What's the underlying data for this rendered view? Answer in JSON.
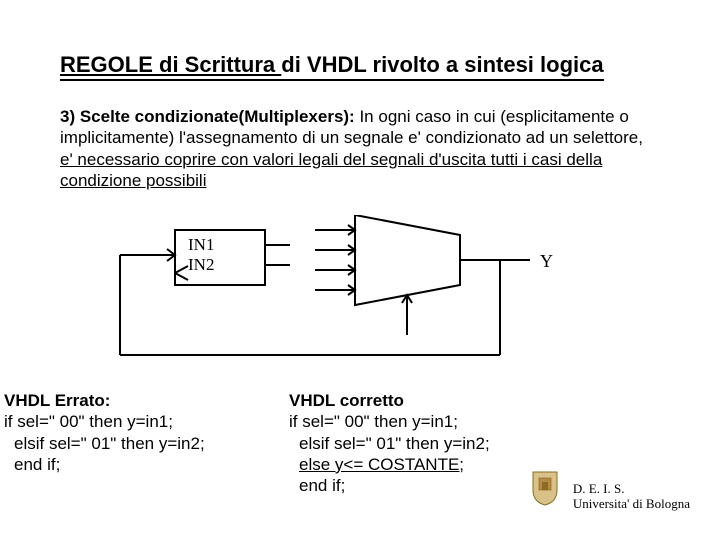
{
  "title": {
    "part1": "REGOLE di Scrittura ",
    "part2": "di VHDL rivolto a sintesi logica"
  },
  "paragraph": {
    "lead": "3) Scelte condizionate(Multiplexers):",
    "rest1": " In ogni caso in cui (esplicitamente o implicitamente) l'assegnamento di un segnale e' condizionato ad un selettore, ",
    "under": "e' necessario coprire con valori legali del segnali d'uscita tutti i casi della condizione possibili"
  },
  "diagram": {
    "in1": "IN1",
    "in2": "IN2",
    "out": "Y"
  },
  "left": {
    "header": "VHDL Errato:",
    "l1": "if sel=\" 00\" then y=in1;",
    "l2": "elsif sel=\" 01\" then y=in2;",
    "l3": "end if;"
  },
  "right": {
    "header": "VHDL  corretto",
    "l1": "if sel=\" 00\" then y=in1;",
    "l2": "elsif sel=\" 01\" then y=in2;",
    "l3": "else  y<= COSTANTE;",
    "l4": "end if;"
  },
  "footer": {
    "l1": "D. E. I. S.",
    "l2": "Universita' di Bologna"
  }
}
